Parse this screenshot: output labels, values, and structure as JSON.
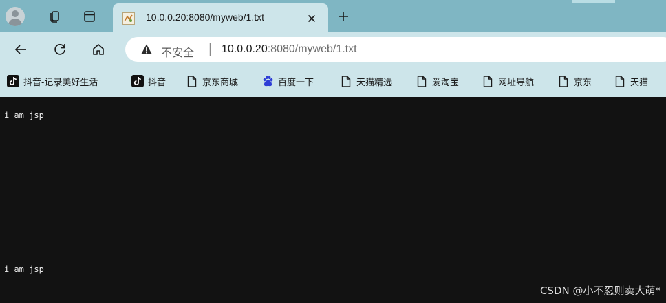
{
  "browser": {
    "tab": {
      "title": "10.0.0.20:8080/myweb/1.txt",
      "favicon": "jsp-tomcat-icon"
    },
    "address": {
      "security_label": "不安全",
      "separator": "|",
      "url_host": "10.0.0.20",
      "url_rest": ":8080/myweb/1.txt"
    },
    "bookmarks": [
      {
        "label": "抖音-记录美好生活",
        "icon": "tiktok-icon"
      },
      {
        "label": "抖音",
        "icon": "tiktok-icon"
      },
      {
        "label": "京东商城",
        "icon": "page-icon"
      },
      {
        "label": "百度一下",
        "icon": "baidu-paw-icon"
      },
      {
        "label": "天猫精选",
        "icon": "page-icon"
      },
      {
        "label": "爱淘宝",
        "icon": "page-icon"
      },
      {
        "label": "网址导航",
        "icon": "page-icon"
      },
      {
        "label": "京东",
        "icon": "page-icon"
      },
      {
        "label": "天猫",
        "icon": "page-icon"
      }
    ],
    "colors": {
      "tab_strip": "#7fb6c3",
      "toolbar": "#cde5ea",
      "page_background": "#121212"
    }
  },
  "page": {
    "lines": [
      "i am jsp",
      "i am jsp"
    ]
  },
  "watermark": "CSDN @小不忍则卖大萌*"
}
